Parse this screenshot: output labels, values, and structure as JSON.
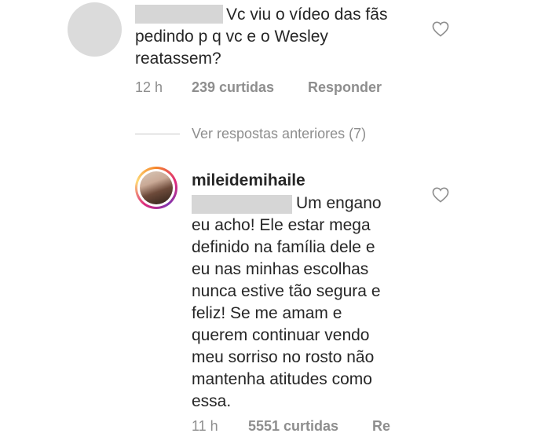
{
  "comment1": {
    "text_line1": "Vc viu o vídeo das fãs",
    "text_line2": "pedindo p q vc e o Wesley",
    "text_line3": "reatassem?",
    "time": "12 h",
    "likes": "239 curtidas",
    "reply_label": "Responder"
  },
  "replies": {
    "view_previous": "Ver respostas anteriores (7)"
  },
  "comment2": {
    "username": "mileidemihaile",
    "text_lines": [
      "Um engano",
      "eu acho! Ele estar mega",
      "definido na família dele e",
      "eu nas minhas escolhas",
      "nunca estive tão segura e",
      "feliz! Se me amam e",
      "querem continuar vendo",
      "meu sorriso no rosto não",
      "mantenha atitudes como",
      "essa."
    ],
    "time": "11 h",
    "likes": "5551 curtidas",
    "reply_label": "Re"
  },
  "icons": [
    "heart-icon"
  ],
  "colors": {
    "text": "#262626",
    "meta": "#8e8e8e",
    "redaction": "#d6d6d6"
  }
}
